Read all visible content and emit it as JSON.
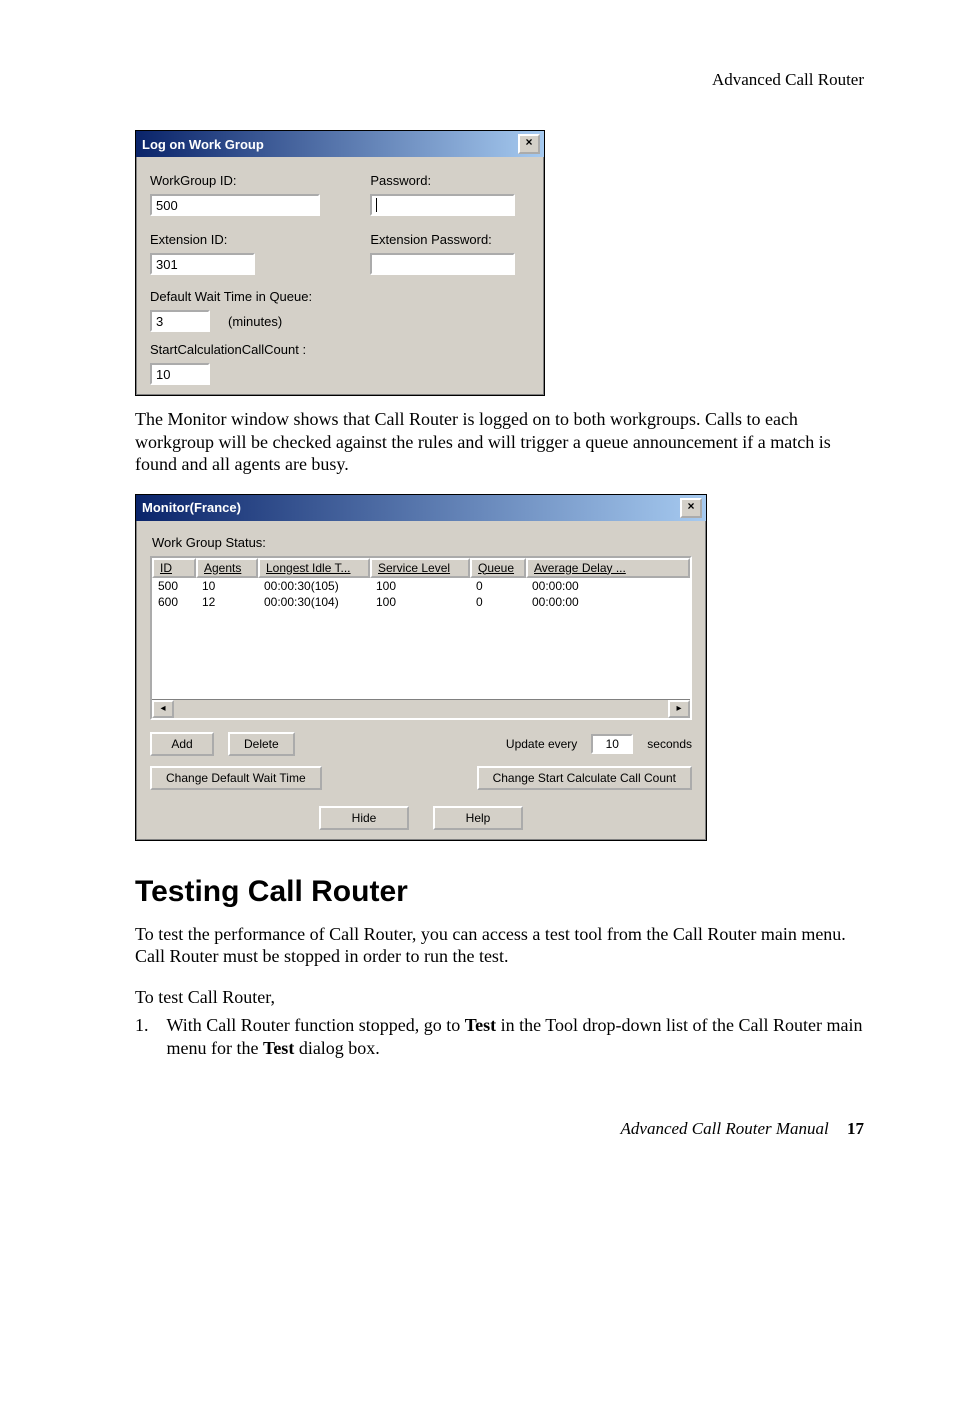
{
  "header": {
    "running": "Advanced Call Router"
  },
  "dialog1": {
    "title": "Log on Work Group",
    "labels": {
      "workgroup_id": "WorkGroup ID:",
      "password": "Password:",
      "extension_id": "Extension ID:",
      "extension_password": "Extension Password:",
      "default_wait": "Default Wait Time in Queue:",
      "minutes": "(minutes)",
      "start_calc": "StartCalculationCallCount :"
    },
    "values": {
      "workgroup_id": "500",
      "password": "",
      "extension_id": "301",
      "extension_password": "",
      "default_wait": "3",
      "start_calc": "10"
    }
  },
  "para1": "The Monitor window shows that Call Router is logged on to both workgroups. Calls to each workgroup will be checked against the rules and will trigger a queue announcement if a match is found and all agents are busy.",
  "dialog2": {
    "title": "Monitor(France)",
    "work_group_status_label": "Work Group Status:",
    "columns": {
      "id": "ID",
      "agents": "Agents",
      "longest": "Longest Idle T...",
      "service": "Service Level",
      "queue": "Queue",
      "avg": "Average Delay ..."
    },
    "rows": [
      {
        "id": "500",
        "agents": "10",
        "longest": "00:00:30(105)",
        "service": "100",
        "queue": "0",
        "avg": "00:00:00"
      },
      {
        "id": "600",
        "agents": "12",
        "longest": "00:00:30(104)",
        "service": "100",
        "queue": "0",
        "avg": "00:00:00"
      }
    ],
    "buttons": {
      "add": "Add",
      "delete": "Delete",
      "change_wait": "Change Default Wait Time",
      "change_start": "Change Start Calculate Call Count",
      "hide": "Hide",
      "help": "Help"
    },
    "update": {
      "prefix": "Update every",
      "value": "10",
      "suffix": "seconds"
    }
  },
  "section_title": "Testing Call Router",
  "para2": "To test the performance of Call Router, you can access a test tool from the Call Router main menu. Call Router must be stopped in order to run the test.",
  "para3": "To test Call Router,",
  "list1": {
    "num": "1.",
    "text_a": "With Call Router function stopped, go to ",
    "bold_a": "Test",
    "text_b": " in the Tool drop-down list of the Call Router main menu for the ",
    "bold_b": "Test",
    "text_c": " dialog box."
  },
  "footer": {
    "title": "Advanced Call Router Manual",
    "page": "17"
  }
}
